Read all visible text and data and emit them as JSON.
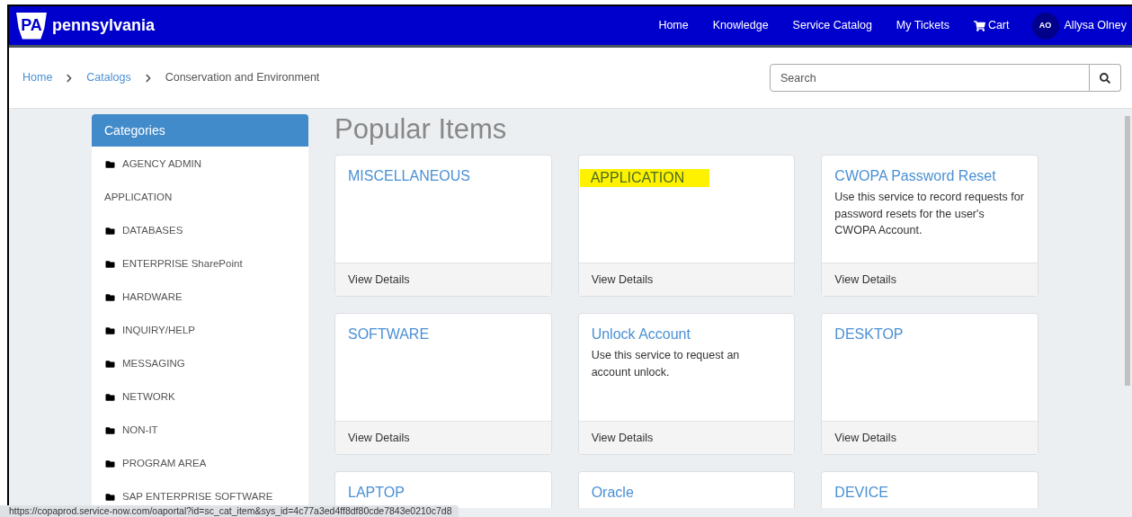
{
  "header": {
    "logo_mark": "PA",
    "logo_text": "pennsylvania",
    "nav": [
      {
        "label": "Home",
        "kind": "link"
      },
      {
        "label": "Knowledge",
        "kind": "link"
      },
      {
        "label": "Service Catalog",
        "kind": "link"
      },
      {
        "label": "My Tickets",
        "kind": "link"
      },
      {
        "label": "Cart",
        "kind": "cart"
      }
    ],
    "user": {
      "initials": "AO",
      "name": "Allysa Olney"
    }
  },
  "breadcrumb": [
    {
      "label": "Home",
      "kind": "link"
    },
    {
      "label": "Catalogs",
      "kind": "link"
    },
    {
      "label": "Conservation and Environment",
      "kind": "current"
    }
  ],
  "search": {
    "placeholder": "Search"
  },
  "sidebar": {
    "title": "Categories",
    "items": [
      {
        "label": "AGENCY ADMIN",
        "kind": "folder"
      },
      {
        "label": "APPLICATION",
        "kind": "plain"
      },
      {
        "label": "DATABASES",
        "kind": "folder"
      },
      {
        "label": "ENTERPRISE SharePoint",
        "kind": "folder"
      },
      {
        "label": "HARDWARE",
        "kind": "folder"
      },
      {
        "label": "INQUIRY/HELP",
        "kind": "folder"
      },
      {
        "label": "MESSAGING",
        "kind": "folder"
      },
      {
        "label": "NETWORK",
        "kind": "folder"
      },
      {
        "label": "NON-IT",
        "kind": "folder"
      },
      {
        "label": "PROGRAM AREA",
        "kind": "folder"
      },
      {
        "label": "SAP ENTERPRISE SOFTWARE",
        "kind": "folder"
      }
    ]
  },
  "main": {
    "title": "Popular Items",
    "cards": [
      {
        "title": "MISCELLANEOUS",
        "highlighted": false,
        "footer": "View Details"
      },
      {
        "title": "APPLICATION",
        "highlighted": true,
        "footer": "View Details"
      },
      {
        "title": "CWOPA Password Reset",
        "description": "Use this service to record requests for password resets for the user's CWOPA Account.",
        "highlighted": false,
        "footer": "View Details"
      },
      {
        "title": "SOFTWARE",
        "highlighted": false,
        "footer": "View Details"
      },
      {
        "title": "Unlock Account",
        "description": "Use this service to request an account unlock.",
        "highlighted": false,
        "footer": "View Details"
      },
      {
        "title": "DESKTOP",
        "highlighted": false,
        "footer": "View Details"
      },
      {
        "title": "LAPTOP",
        "highlighted": false
      },
      {
        "title": "Oracle",
        "highlighted": false
      },
      {
        "title": "DEVICE",
        "highlighted": false
      }
    ]
  },
  "status_bar": {
    "url": "https://copaprod.service-now.com/oaportal?id=sc_cat_item&sys_id=4c77a3ed4ff8df80cde7843e0210c7d8"
  }
}
